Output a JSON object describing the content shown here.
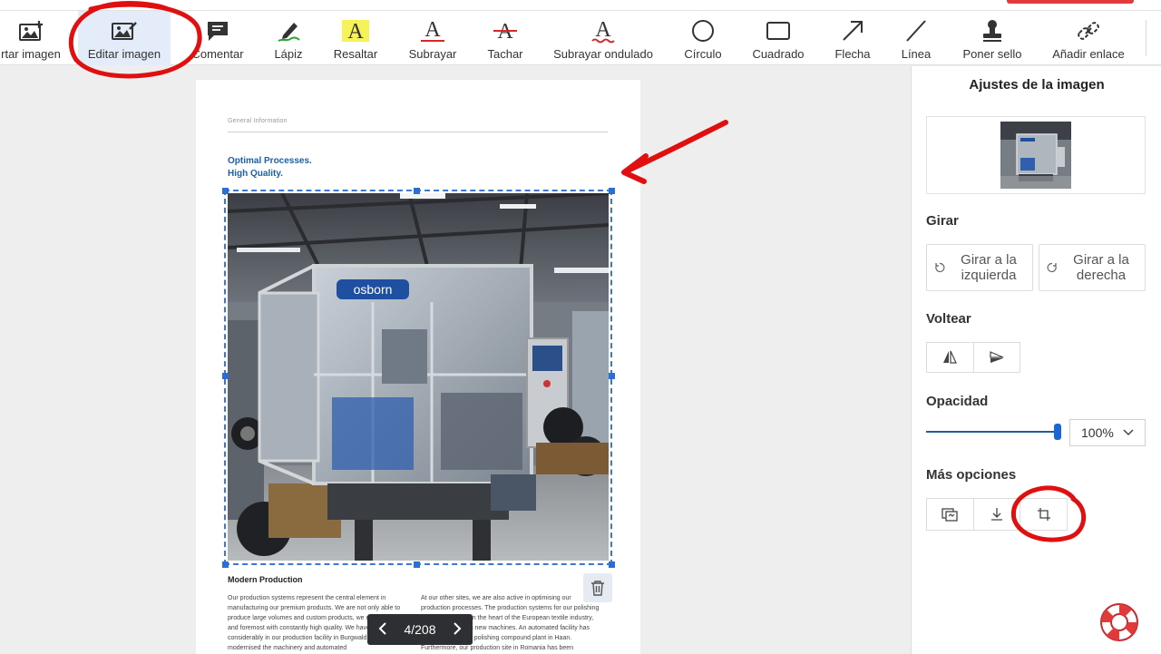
{
  "toolbar": {
    "tools": [
      {
        "label": "rtar imagen",
        "icon": "add-image-icon"
      },
      {
        "label": "Editar imagen",
        "icon": "edit-image-icon",
        "active": true
      },
      {
        "label": "Comentar",
        "icon": "comment-icon"
      },
      {
        "label": "Lápiz",
        "icon": "pencil-icon"
      },
      {
        "label": "Resaltar",
        "icon": "highlight-icon"
      },
      {
        "label": "Subrayar",
        "icon": "underline-icon"
      },
      {
        "label": "Tachar",
        "icon": "strikethrough-icon"
      },
      {
        "label": "Subrayar ondulado",
        "icon": "squiggly-underline-icon"
      },
      {
        "label": "Círculo",
        "icon": "circle-icon"
      },
      {
        "label": "Cuadrado",
        "icon": "square-icon"
      },
      {
        "label": "Flecha",
        "icon": "arrow-icon"
      },
      {
        "label": "Línea",
        "icon": "line-icon"
      },
      {
        "label": "Poner sello",
        "icon": "stamp-icon"
      },
      {
        "label": "Añadir enlace",
        "icon": "link-icon"
      }
    ]
  },
  "document": {
    "header": "General Information",
    "title_line1": "Optimal Processes.",
    "title_line2": "High Quality.",
    "image_brand": "osborn",
    "section_title": "Modern Production",
    "col1": "Our production systems represent the central element in manufacturing our premium products. We are not only able to produce large volumes and custom products, we offer them first and foremost with constantly high quality. We have invested considerably in our production facility in Burgwald. We have modernised the machinery and automated",
    "col2": "At our other sites, we are also active in optimising our production processes. The production systems for our polishing division in Oelde, in the heart of the European textile industry, was equipped with new machines. An automated facility has been added to our polishing compound plant in Haan. Furthermore, our production site in Romania has been"
  },
  "pager": {
    "label": "4/208"
  },
  "panel": {
    "title": "Ajustes de la imagen",
    "rotate_label": "Girar",
    "rotate_left_line1": "Girar a la",
    "rotate_left_line2": "izquierda",
    "rotate_right_line1": "Girar a la",
    "rotate_right_line2": "derecha",
    "flip_label": "Voltear",
    "opacity_label": "Opacidad",
    "opacity_value": "100%",
    "opacity_fraction": 1.0,
    "more_label": "Más opciones"
  },
  "colors": {
    "accent": "#2b6fd6",
    "title_blue": "#1b5fa6",
    "annotation_red": "#e01010"
  }
}
